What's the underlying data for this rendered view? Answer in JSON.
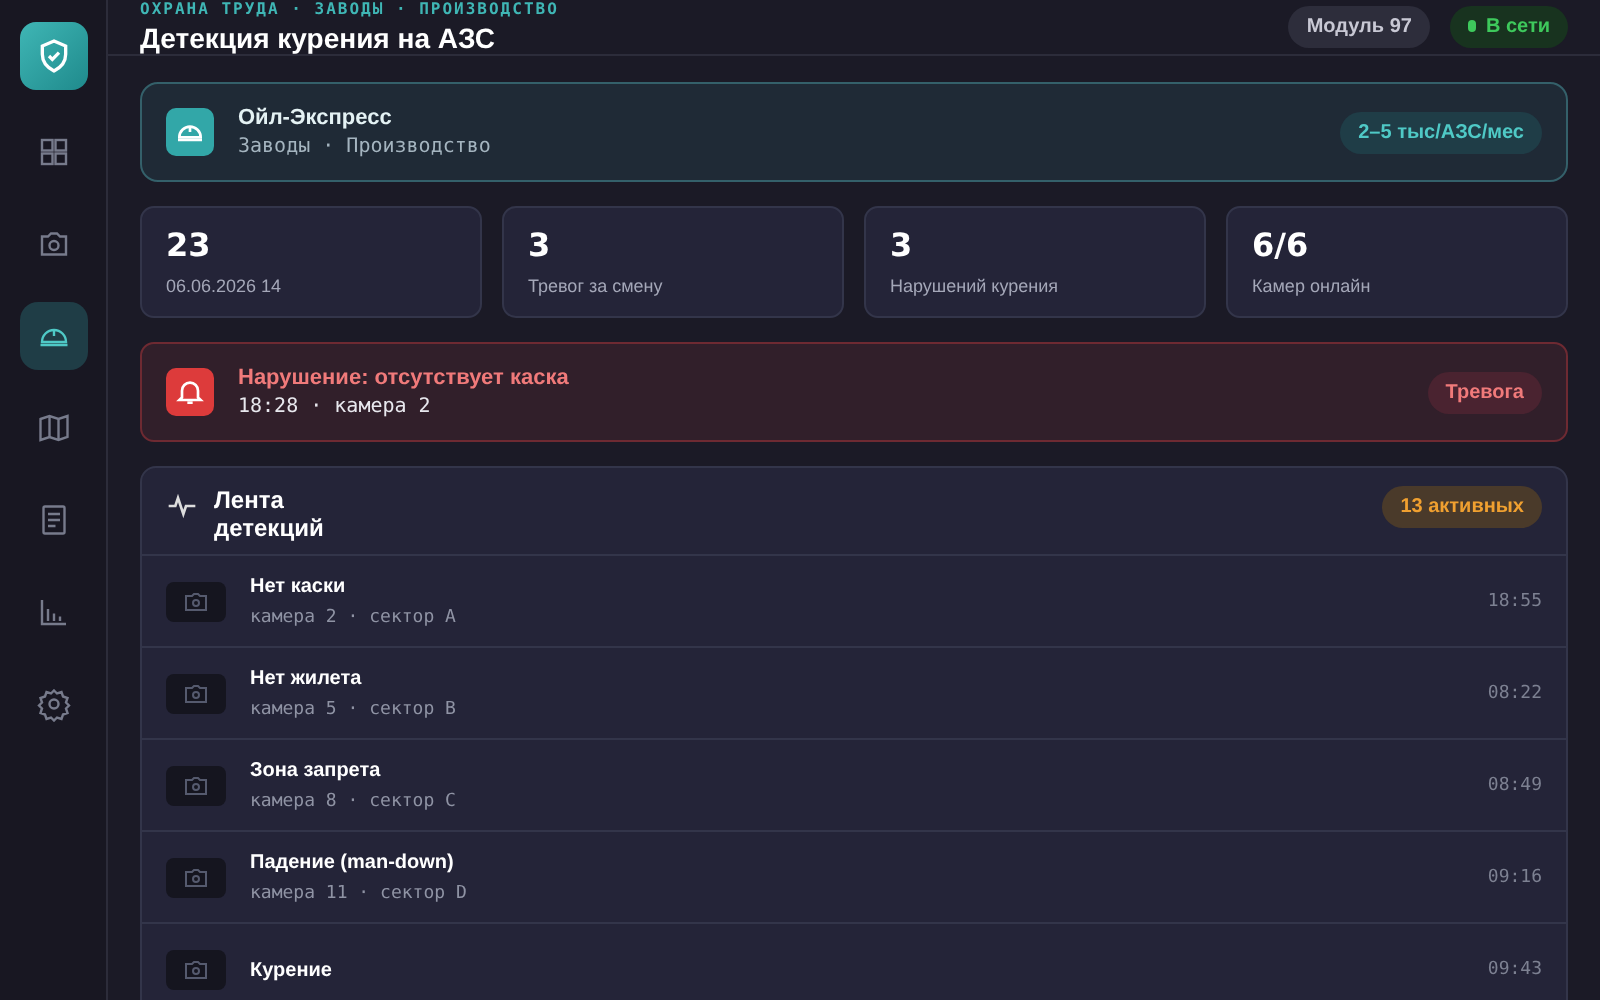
{
  "sidebar": {
    "items": [
      {
        "kind": "grid",
        "selected": false
      },
      {
        "kind": "camera",
        "selected": false
      },
      {
        "kind": "helmet",
        "selected": true
      },
      {
        "kind": "map",
        "selected": false
      },
      {
        "kind": "doc",
        "selected": false
      },
      {
        "kind": "chart",
        "selected": false
      },
      {
        "kind": "gear",
        "selected": false
      }
    ]
  },
  "header": {
    "breadcrumb": "ОХРАНА ТРУДА · ЗАВОДЫ · ПРОИЗВОДСТВО",
    "title": "Детекция курения на АЗС",
    "module_badge": "Модуль 97",
    "status": {
      "label": "В сети",
      "online": true
    }
  },
  "company": {
    "name": "Ойл-Экспресс",
    "subtitle": "Заводы · Производство",
    "price_badge": "2–5 тыс/АЗС/мес"
  },
  "stats": [
    {
      "value": "23",
      "label": "06.06.2026 14"
    },
    {
      "value": "3",
      "label": "Тревог за смену"
    },
    {
      "value": "3",
      "label": "Нарушений курения"
    },
    {
      "value": "6/6",
      "label": "Камер онлайн"
    }
  ],
  "alert": {
    "title": "Нарушение: отсутствует каска",
    "meta": "18:28 · камера 2",
    "badge": "Тревога"
  },
  "feed": {
    "title": "Лента детекций",
    "active_badge": "13 активных",
    "items": [
      {
        "title": "Нет каски",
        "meta": "камера 2 · сектор A",
        "time": "18:55"
      },
      {
        "title": "Нет жилета",
        "meta": "камера 5 · сектор B",
        "time": "08:22"
      },
      {
        "title": "Зона запрета",
        "meta": "камера 8 · сектор C",
        "time": "08:49"
      },
      {
        "title": "Падение (man-down)",
        "meta": "камера 11 · сектор D",
        "time": "09:16"
      },
      {
        "title": "Курение",
        "time": "09:43"
      }
    ]
  }
}
